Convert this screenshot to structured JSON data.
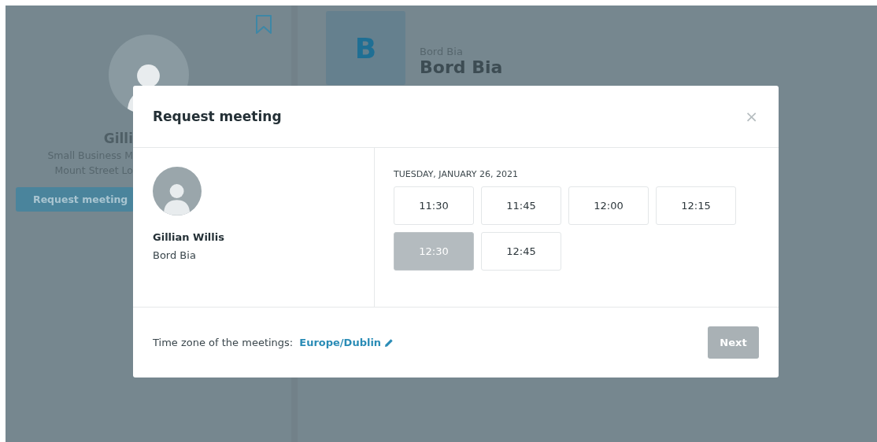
{
  "background": {
    "profile": {
      "name": "Gilli",
      "title": "Small Business M",
      "company": "Mount Street Lo",
      "button": "Request meeting"
    },
    "organization": {
      "initial": "B",
      "label": "Bord Bia",
      "name": "Bord Bia"
    }
  },
  "modal": {
    "title": "Request meeting",
    "close": "×",
    "person": {
      "name": "Gillian Willis",
      "company": "Bord Bia"
    },
    "date": "TUESDAY, JANUARY 26, 2021",
    "slots": [
      {
        "time": "11:30",
        "disabled": false
      },
      {
        "time": "11:45",
        "disabled": false
      },
      {
        "time": "12:00",
        "disabled": false
      },
      {
        "time": "12:15",
        "disabled": false
      },
      {
        "time": "12:30",
        "disabled": true
      },
      {
        "time": "12:45",
        "disabled": false
      }
    ],
    "timezone_label": "Time zone of the meetings:",
    "timezone": "Europe/Dublin",
    "next": {
      "label": "Next",
      "disabled": true
    }
  }
}
